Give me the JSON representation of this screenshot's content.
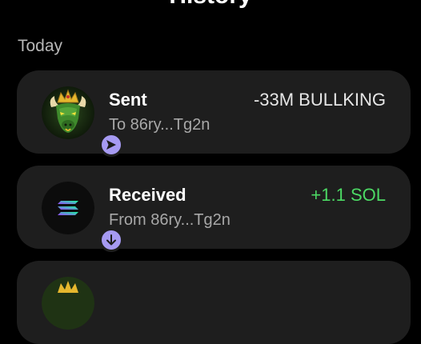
{
  "page": {
    "title": "History"
  },
  "sections": [
    {
      "label": "Today",
      "transactions": [
        {
          "type": "Sent",
          "counterparty": "To 86ry...Tg2n",
          "amount": "-33M BULLKING",
          "amount_color": "#e6e6e6",
          "token_icon": "bull-king-token-icon",
          "badge_icon": "send-arrow-icon"
        },
        {
          "type": "Received",
          "counterparty": "From 86ry...Tg2n",
          "amount": "+1.1 SOL",
          "amount_color": "#4cd964",
          "token_icon": "solana-token-icon",
          "badge_icon": "receive-arrow-icon"
        }
      ]
    }
  ],
  "colors": {
    "background": "#000000",
    "card": "#1e1e1e",
    "badge": "#a69af2",
    "positive": "#4cd964"
  }
}
